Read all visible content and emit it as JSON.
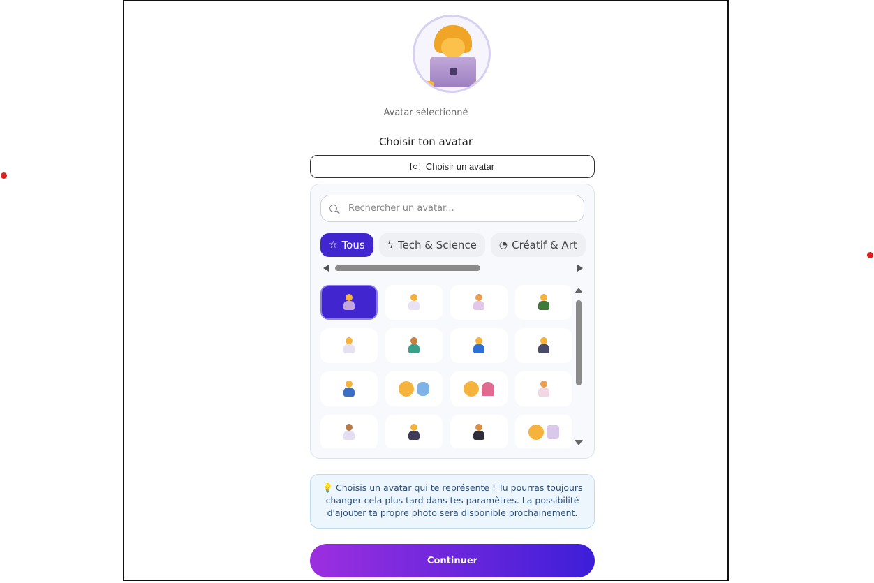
{
  "avatar": {
    "selected_label": "Avatar sélectionné"
  },
  "chooser": {
    "title": "Choisir ton avatar",
    "button_label": "Choisir un avatar",
    "button_icon": "camera-icon"
  },
  "search": {
    "placeholder": "Rechercher un avatar...",
    "value": ""
  },
  "tabs": [
    {
      "label": "Tous",
      "icon": "star-icon",
      "active": true
    },
    {
      "label": "Tech & Science",
      "icon": "bolt-icon",
      "active": false
    },
    {
      "label": "Créatif & Art",
      "icon": "palette-icon",
      "active": false
    }
  ],
  "grid_items": [
    {
      "name": "woman-technologist",
      "selected": true
    },
    {
      "name": "woman-health-worker"
    },
    {
      "name": "man-artist"
    },
    {
      "name": "woman-teacher"
    },
    {
      "name": "woman-doctor"
    },
    {
      "name": "woman-farmer"
    },
    {
      "name": "man-factory-worker"
    },
    {
      "name": "woman-judge"
    },
    {
      "name": "woman-mechanic"
    },
    {
      "name": "woman-performing-arts"
    },
    {
      "name": "woman-circus"
    },
    {
      "name": "woman-cook"
    },
    {
      "name": "woman-astronaut"
    },
    {
      "name": "woman-pilot"
    },
    {
      "name": "student-graduate"
    },
    {
      "name": "woman-hospital"
    }
  ],
  "tip": {
    "icon": "💡",
    "text": "Choisis un avatar qui te représente ! Tu pourras toujours changer cela plus tard dans tes paramètres. La possibilité d'ajouter ta propre photo sera disponible prochainement."
  },
  "continue": {
    "label": "Continuer"
  },
  "colors": {
    "accent": "#4126d0",
    "gradient_start": "#9c2fe0",
    "gradient_end": "#3d1ed8",
    "tip_bg": "#eef6fd"
  }
}
